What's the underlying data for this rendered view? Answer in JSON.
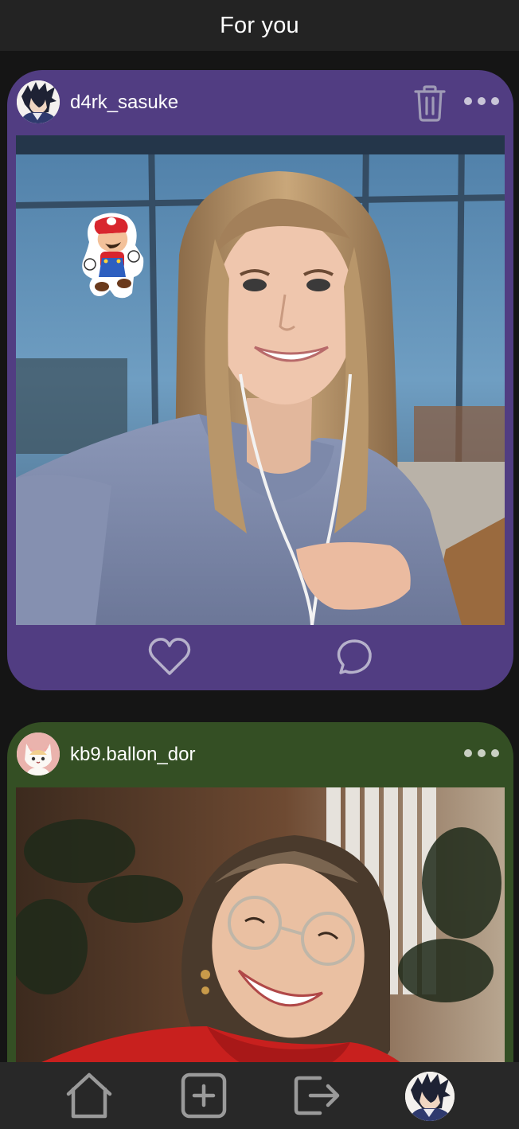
{
  "header": {
    "title": "For you"
  },
  "theme": {
    "background": "#151515",
    "bar": "#232323",
    "bottom_bar": "#282828",
    "icon_color": "#9a9a9a"
  },
  "posts": [
    {
      "username": "d4rk_sasuke",
      "card_color": "#513d82",
      "avatar_icon": "sasuke-avatar-icon",
      "has_delete": true,
      "sticker": "mario-sticker",
      "actions": [
        "heart-icon",
        "comment-icon"
      ]
    },
    {
      "username": "kb9.ballon_dor",
      "card_color": "#344f24",
      "avatar_icon": "cat-avatar-icon",
      "has_delete": false
    }
  ],
  "bottom_nav": {
    "items": [
      "home-icon",
      "add-post-icon",
      "logout-icon",
      "profile-avatar"
    ]
  }
}
